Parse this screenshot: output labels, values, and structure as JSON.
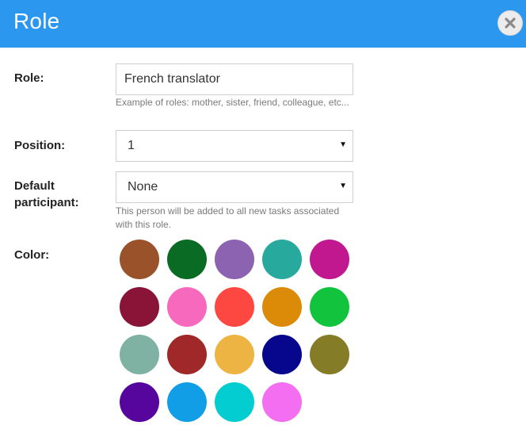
{
  "dialog": {
    "title": "Role",
    "close_icon": "close-icon"
  },
  "form": {
    "role": {
      "label": "Role:",
      "value": "French translator",
      "help": "Example of roles: mother, sister, friend, colleague, etc..."
    },
    "position": {
      "label": "Position:",
      "value": "1"
    },
    "default_participant": {
      "label_line1": "Default",
      "label_line2": "participant:",
      "value": "None",
      "help": "This person will be added to all new tasks associated with this role."
    },
    "color": {
      "label": "Color:",
      "swatches": [
        "#9a522a",
        "#0a6b25",
        "#8c63b0",
        "#27aa9d",
        "#c1188f",
        "#8a1338",
        "#f769bd",
        "#fc4840",
        "#db8b08",
        "#12c43d",
        "#80b2a3",
        "#a02828",
        "#eeb443",
        "#06078c",
        "#857c27",
        "#56069c",
        "#129ee6",
        "#03cdd0",
        "#f36ef0"
      ]
    }
  },
  "colors": {
    "header": "#2b97ee"
  }
}
